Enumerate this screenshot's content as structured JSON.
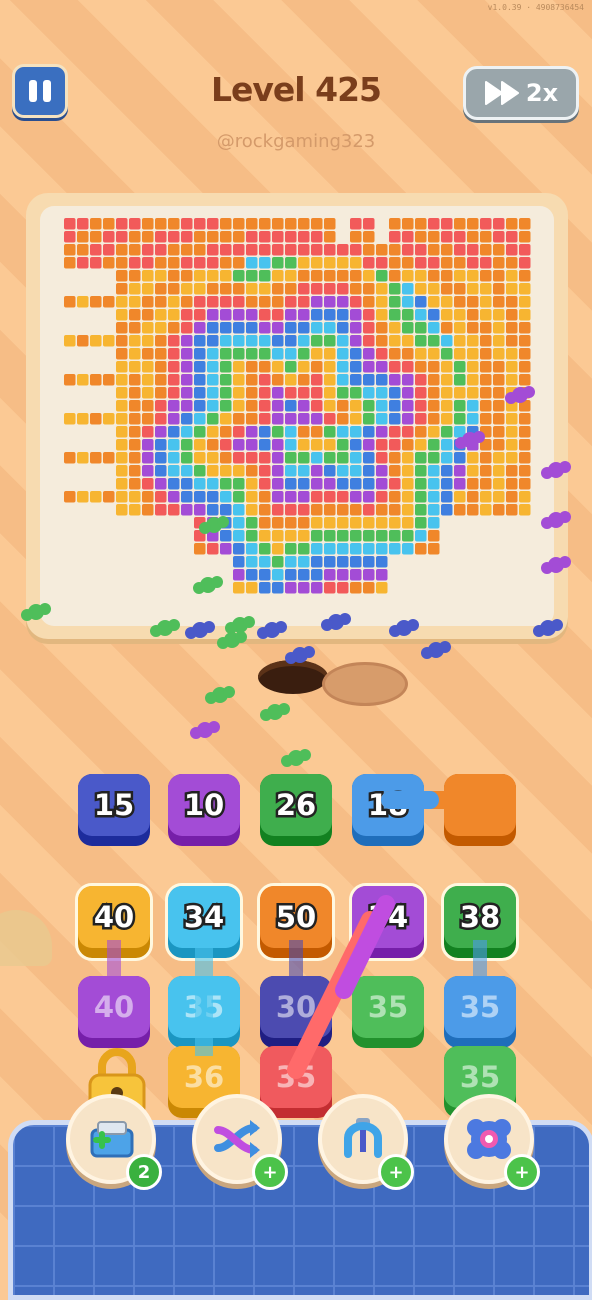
{
  "status": {
    "version": "v1.0.39 · 4908736454"
  },
  "header": {
    "title": "Level 425",
    "handle": "@rockgaming323",
    "speed_label": "2x"
  },
  "icons": {
    "pause": "pause-icon",
    "speed": "fast-forward-icon",
    "lock": "padlock-icon"
  },
  "colors": {
    "blue": "#4a59c9",
    "purple": "#a34cd6",
    "green": "#3fae4d",
    "sky": "#4c9be8",
    "orange": "#f0872a",
    "yellow": "#f7b531",
    "cyan": "#48c3ee",
    "red": "#f05a5e",
    "navy": "#4c4bb0",
    "mint": "#4fbe5a"
  },
  "queue": [
    {
      "value": "15",
      "color": "blue"
    },
    {
      "value": "10",
      "color": "purple"
    },
    {
      "value": "26",
      "color": "green"
    },
    {
      "value": "18",
      "color": "sky"
    },
    {
      "value": "",
      "color": "orange"
    }
  ],
  "grid": {
    "row1": [
      {
        "value": "40",
        "color": "yellow"
      },
      {
        "value": "34",
        "color": "cyan"
      },
      {
        "value": "50",
        "color": "orange"
      },
      {
        "value": "34",
        "color": "purple"
      },
      {
        "value": "38",
        "color": "green"
      }
    ],
    "row2": [
      {
        "value": "40",
        "color": "purple"
      },
      {
        "value": "35",
        "color": "cyan"
      },
      {
        "value": "30",
        "color": "navy"
      },
      {
        "value": "35",
        "color": "mint"
      },
      {
        "value": "35",
        "color": "sky"
      }
    ],
    "row3": [
      {
        "value": "36",
        "color": "yellow"
      },
      {
        "value": "35",
        "color": "red"
      },
      {
        "value": "35",
        "color": "mint"
      }
    ]
  },
  "boosters": [
    {
      "name": "add-slot",
      "count": "2"
    },
    {
      "name": "shuffle",
      "count": "+"
    },
    {
      "name": "magnet",
      "count": "+"
    },
    {
      "name": "freeze",
      "count": "+"
    }
  ]
}
